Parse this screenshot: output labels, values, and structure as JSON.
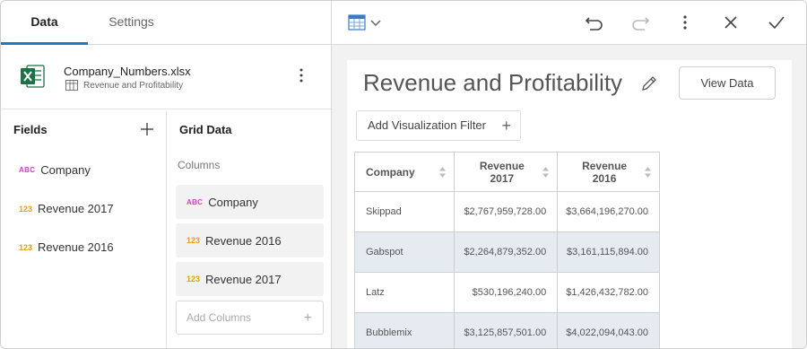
{
  "tabs": [
    {
      "label": "Data"
    },
    {
      "label": "Settings"
    }
  ],
  "toolbar": {
    "viz_type_icon": "grid-table-icon",
    "icons": [
      "undo-icon",
      "redo-icon",
      "more-vertical-icon",
      "close-icon",
      "check-icon"
    ]
  },
  "file": {
    "name": "Company_Numbers.xlsx",
    "sheet": "Revenue and Profitability",
    "icon": "excel-icon"
  },
  "fields": {
    "title": "Fields",
    "items": [
      {
        "type": "ABC",
        "label": "Company"
      },
      {
        "type": "123",
        "label": "Revenue 2017"
      },
      {
        "type": "123",
        "label": "Revenue 2016"
      }
    ]
  },
  "grid_data": {
    "title": "Grid Data",
    "columns_label": "Columns",
    "columns": [
      {
        "type": "ABC",
        "label": "Company"
      },
      {
        "type": "123",
        "label": "Revenue 2016"
      },
      {
        "type": "123",
        "label": "Revenue 2017"
      }
    ],
    "add_columns_placeholder": "Add Columns"
  },
  "visualization": {
    "title": "Revenue and Profitability",
    "view_data_label": "View Data",
    "filter_label": "Add Visualization Filter",
    "table": {
      "headers": [
        "Company",
        "Revenue\n2017",
        "Revenue\n2016"
      ],
      "rows": [
        [
          "Skippad",
          "$2,767,959,728.00",
          "$3,664,196,270.00"
        ],
        [
          "Gabspot",
          "$2,264,879,352.00",
          "$3,161,115,894.00"
        ],
        [
          "Latz",
          "$530,196,240.00",
          "$1,426,432,782.00"
        ],
        [
          "Bubblemix",
          "$3,125,857,501.00",
          "$4,022,094,043.00"
        ]
      ]
    }
  },
  "colors": {
    "accent": "#1f7ac4",
    "abc_badge": "#d63ad6",
    "num_badge": "#f29b16",
    "excel_green": "#1e7145",
    "alt_row": "#e6ebf2"
  }
}
